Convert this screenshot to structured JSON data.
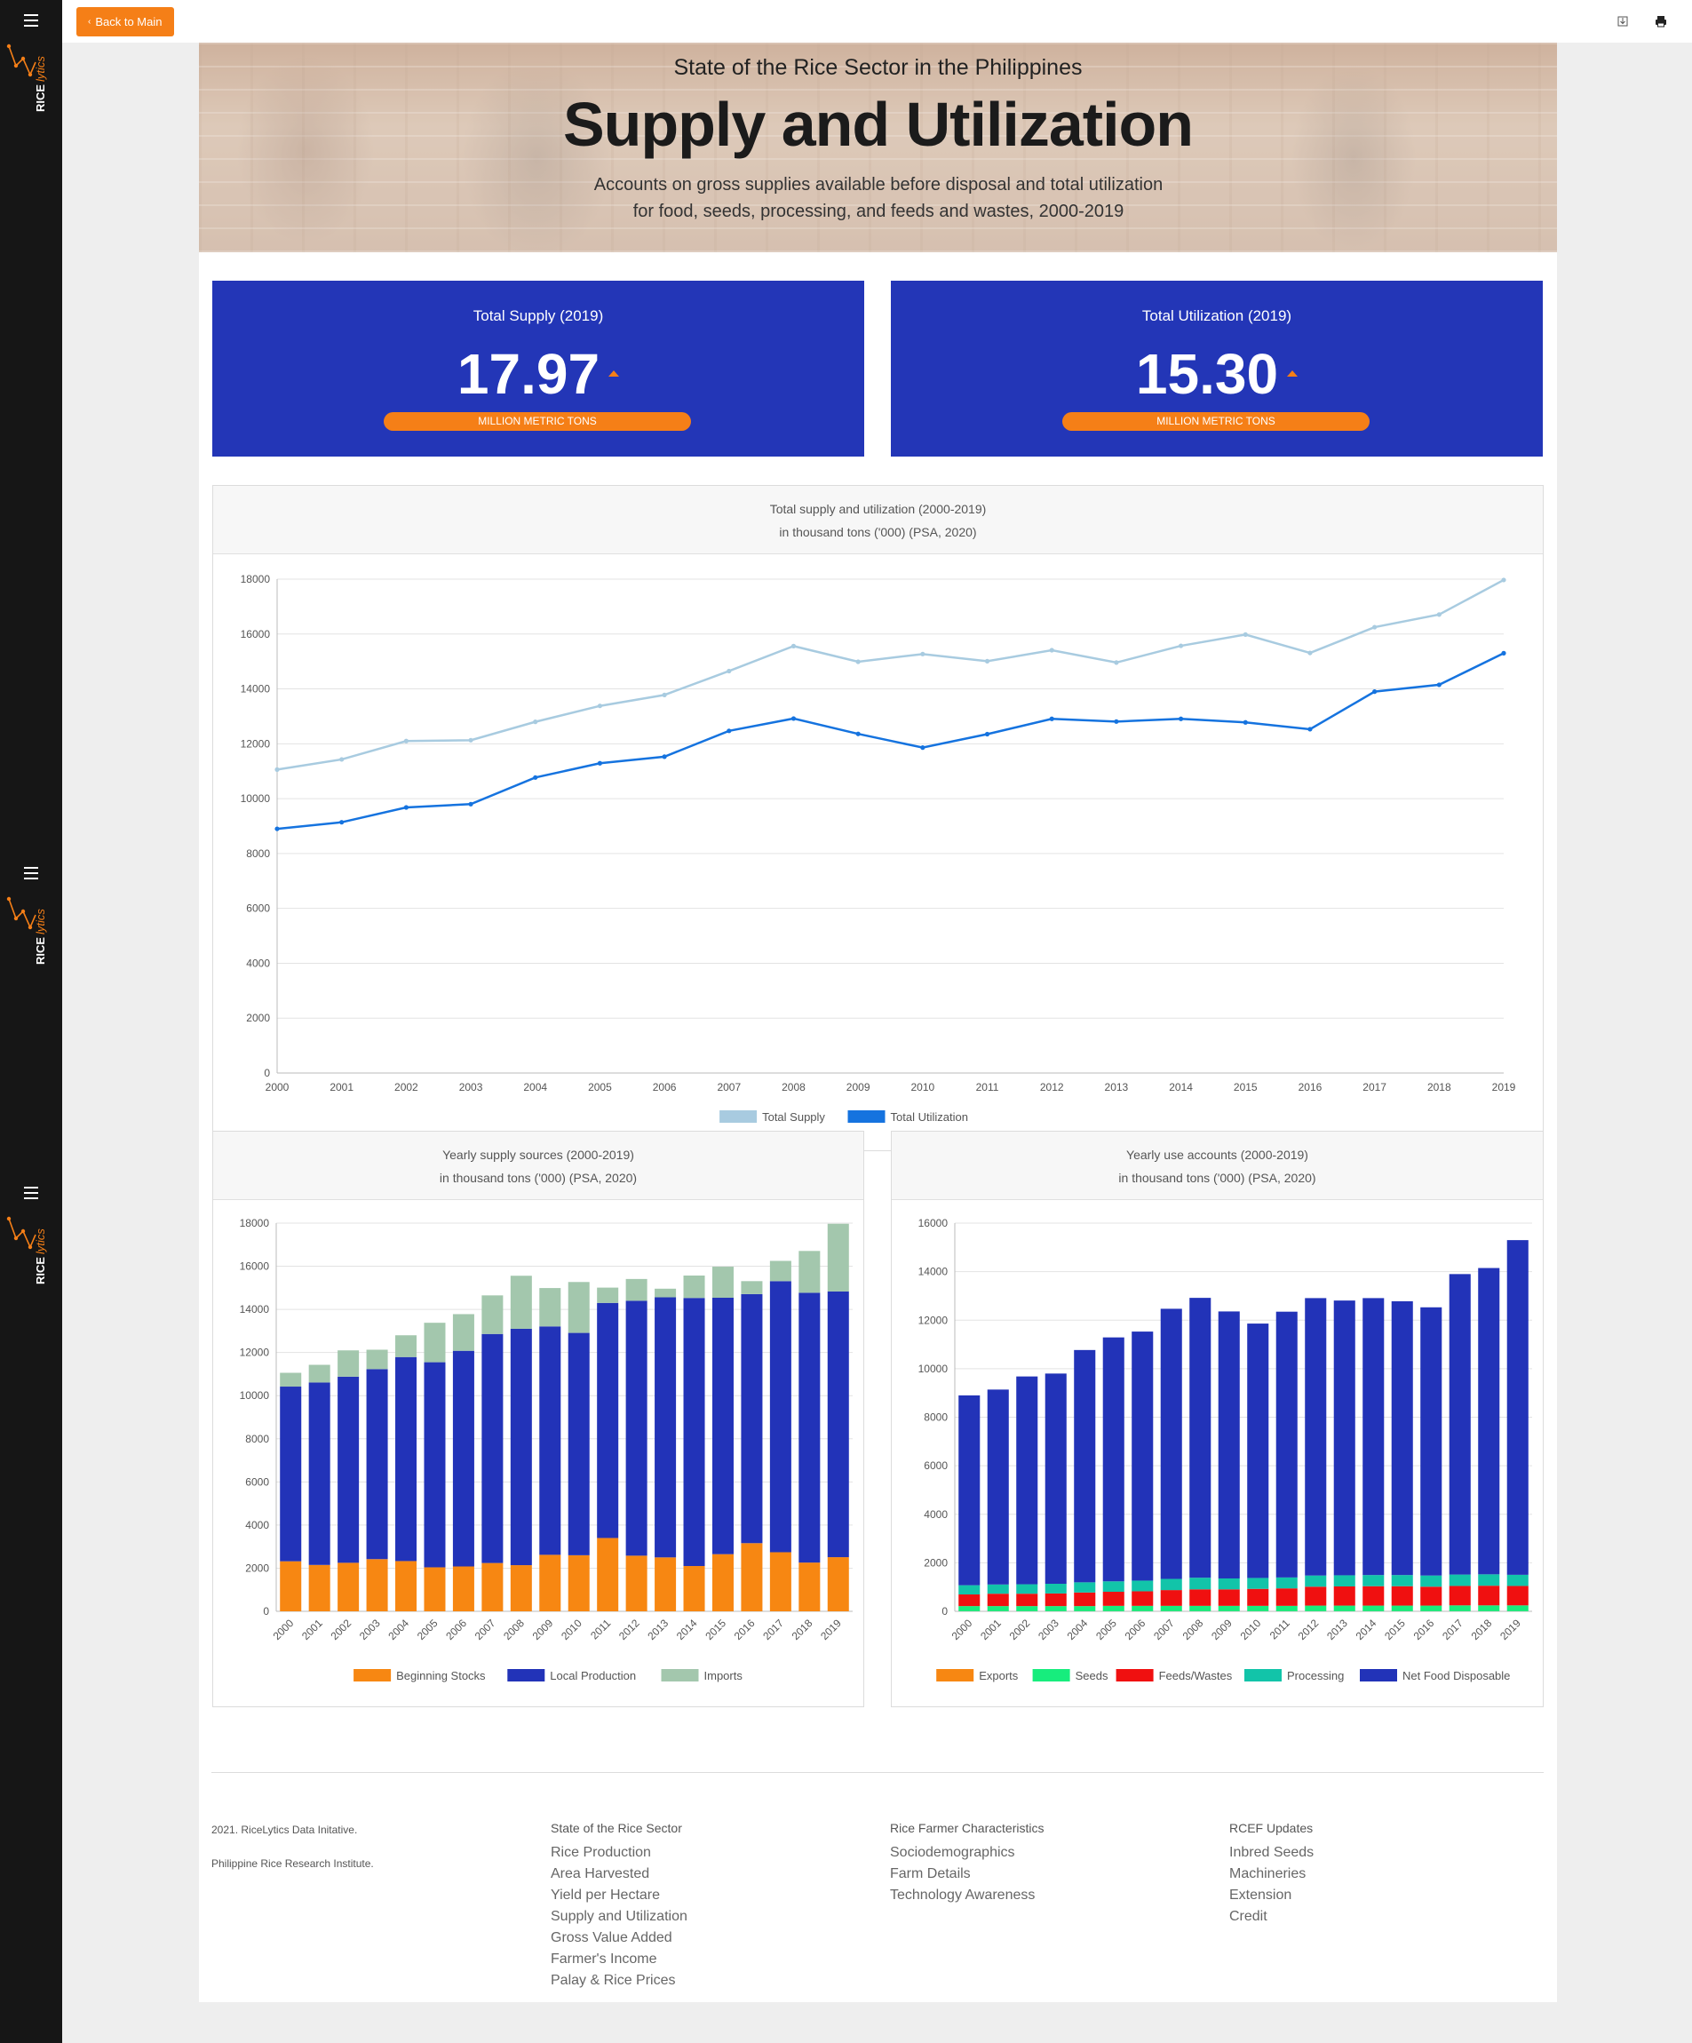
{
  "topbar": {
    "back_label": "Back to Main"
  },
  "sidebar": {
    "brand_text": "RICE",
    "brand_script": "lytics"
  },
  "hero": {
    "kicker": "State of the Rice Sector in the Philippines",
    "title": "Supply and Utilization",
    "description_line1": "Accounts on gross supplies available before disposal and total utilization",
    "description_line2": "for food, seeds, processing, and feeds and wastes, 2000-2019"
  },
  "kpis": [
    {
      "label": "Total Supply (2019)",
      "value": "17.97",
      "unit": "MILLION METRIC TONS"
    },
    {
      "label": "Total Utilization (2019)",
      "value": "15.30",
      "unit": "MILLION METRIC TONS"
    }
  ],
  "colors": {
    "kpi_bg": "#2336b7",
    "accent": "#f57f17",
    "supply": "#a8cbe0",
    "utilization": "#1573df",
    "beginning": "#f78712",
    "local": "#2233b8",
    "imports": "#a3c7ad",
    "exports": "#f78712",
    "seeds": "#17ed7d",
    "feeds": "#f01010",
    "processing": "#12c4a9",
    "food": "#2233b8"
  },
  "chart_data": [
    {
      "type": "line",
      "title": "Total supply and utilization (2000-2019)",
      "subtitle": "in thousand tons ('000) (PSA, 2020)",
      "x": [
        "2000",
        "2001",
        "2002",
        "2003",
        "2004",
        "2005",
        "2006",
        "2007",
        "2008",
        "2009",
        "2010",
        "2011",
        "2012",
        "2013",
        "2014",
        "2015",
        "2016",
        "2017",
        "2018",
        "2019"
      ],
      "yticks": [
        "0",
        "2000",
        "4000",
        "6000",
        "8000",
        "10000",
        "12000",
        "14000",
        "16000",
        "18000"
      ],
      "ylim": [
        0,
        18000
      ],
      "grid": true,
      "legend": "bottom",
      "series": [
        {
          "name": "Total Supply",
          "values": [
            11060,
            11430,
            12100,
            12130,
            12800,
            13380,
            13780,
            14650,
            15560,
            14990,
            15270,
            15010,
            15410,
            14960,
            15570,
            15980,
            15310,
            16250,
            16710,
            17970
          ]
        },
        {
          "name": "Total Utilization",
          "values": [
            8900,
            9140,
            9680,
            9800,
            10770,
            11290,
            11530,
            12470,
            12920,
            12360,
            11860,
            12350,
            12910,
            12810,
            12910,
            12780,
            12530,
            13900,
            14150,
            15300
          ]
        }
      ]
    },
    {
      "type": "bar",
      "title": "Yearly supply sources (2000-2019)",
      "subtitle": "in thousand tons ('000) (PSA, 2020)",
      "categories": [
        "2000",
        "2001",
        "2002",
        "2003",
        "2004",
        "2005",
        "2006",
        "2007",
        "2008",
        "2009",
        "2010",
        "2011",
        "2012",
        "2013",
        "2014",
        "2015",
        "2016",
        "2017",
        "2018",
        "2019"
      ],
      "yticks": [
        "0",
        "2000",
        "4000",
        "6000",
        "8000",
        "10000",
        "12000",
        "14000",
        "16000",
        "18000"
      ],
      "ylim": [
        0,
        18000
      ],
      "stacked": true,
      "legend": "bottom",
      "series": [
        {
          "name": "Beginning Stocks",
          "values": [
            2320,
            2150,
            2250,
            2420,
            2330,
            2040,
            2080,
            2240,
            2140,
            2620,
            2600,
            3400,
            2580,
            2500,
            2100,
            2650,
            3160,
            2740,
            2260,
            2510
          ]
        },
        {
          "name": "Local Production",
          "values": [
            8100,
            8460,
            8630,
            8810,
            9460,
            9510,
            10000,
            10620,
            10960,
            10590,
            10310,
            10900,
            11820,
            12060,
            12430,
            11890,
            11550,
            12570,
            12510,
            12320
          ]
        },
        {
          "name": "Imports",
          "values": [
            640,
            820,
            1220,
            900,
            1010,
            1830,
            1700,
            1790,
            2460,
            1780,
            2360,
            710,
            1010,
            400,
            1040,
            1440,
            600,
            940,
            1940,
            3140
          ]
        }
      ]
    },
    {
      "type": "bar",
      "title": "Yearly use accounts (2000-2019)",
      "subtitle": "in thousand tons ('000) (PSA, 2020)",
      "categories": [
        "2000",
        "2001",
        "2002",
        "2003",
        "2004",
        "2005",
        "2006",
        "2007",
        "2008",
        "2009",
        "2010",
        "2011",
        "2012",
        "2013",
        "2014",
        "2015",
        "2016",
        "2017",
        "2018",
        "2019"
      ],
      "yticks": [
        "0",
        "2000",
        "4000",
        "6000",
        "8000",
        "10000",
        "12000",
        "14000",
        "16000"
      ],
      "ylim": [
        0,
        16000
      ],
      "stacked": true,
      "legend": "bottom",
      "series": [
        {
          "name": "Exports",
          "values": [
            5,
            5,
            5,
            5,
            5,
            5,
            5,
            5,
            5,
            5,
            5,
            5,
            5,
            5,
            5,
            5,
            5,
            5,
            5,
            5
          ]
        },
        {
          "name": "Seeds",
          "values": [
            210,
            210,
            210,
            210,
            210,
            220,
            220,
            220,
            220,
            220,
            220,
            220,
            230,
            230,
            230,
            230,
            230,
            240,
            240,
            240
          ]
        },
        {
          "name": "Feeds/Wastes",
          "values": [
            480,
            510,
            510,
            520,
            560,
            580,
            600,
            650,
            680,
            680,
            700,
            720,
            780,
            790,
            800,
            800,
            780,
            800,
            810,
            800
          ]
        },
        {
          "name": "Processing",
          "values": [
            380,
            380,
            390,
            400,
            420,
            430,
            440,
            460,
            480,
            450,
            450,
            450,
            460,
            460,
            460,
            460,
            460,
            470,
            470,
            460
          ]
        },
        {
          "name": "Net Food Disposable",
          "values": [
            7825,
            8035,
            8565,
            8665,
            9575,
            10055,
            10265,
            11135,
            11535,
            11005,
            10485,
            10955,
            11435,
            11325,
            11415,
            11285,
            11055,
            12385,
            12625,
            13795
          ]
        }
      ]
    }
  ],
  "footer": {
    "copyright": "2021. RiceLytics Data Initative.",
    "institute": "Philippine Rice Research Institute.",
    "columns": [
      {
        "head": "State of the Rice Sector",
        "links": [
          "Rice Production",
          "Area Harvested",
          "Yield per Hectare",
          "Supply and Utilization",
          "Gross Value Added",
          "Farmer's Income",
          "Palay & Rice Prices"
        ]
      },
      {
        "head": "Rice Farmer Characteristics",
        "links": [
          "Sociodemographics",
          "Farm Details",
          "Technology Awareness"
        ]
      },
      {
        "head": "RCEF Updates",
        "links": [
          "Inbred Seeds",
          "Machineries",
          "Extension",
          "Credit"
        ]
      }
    ]
  }
}
